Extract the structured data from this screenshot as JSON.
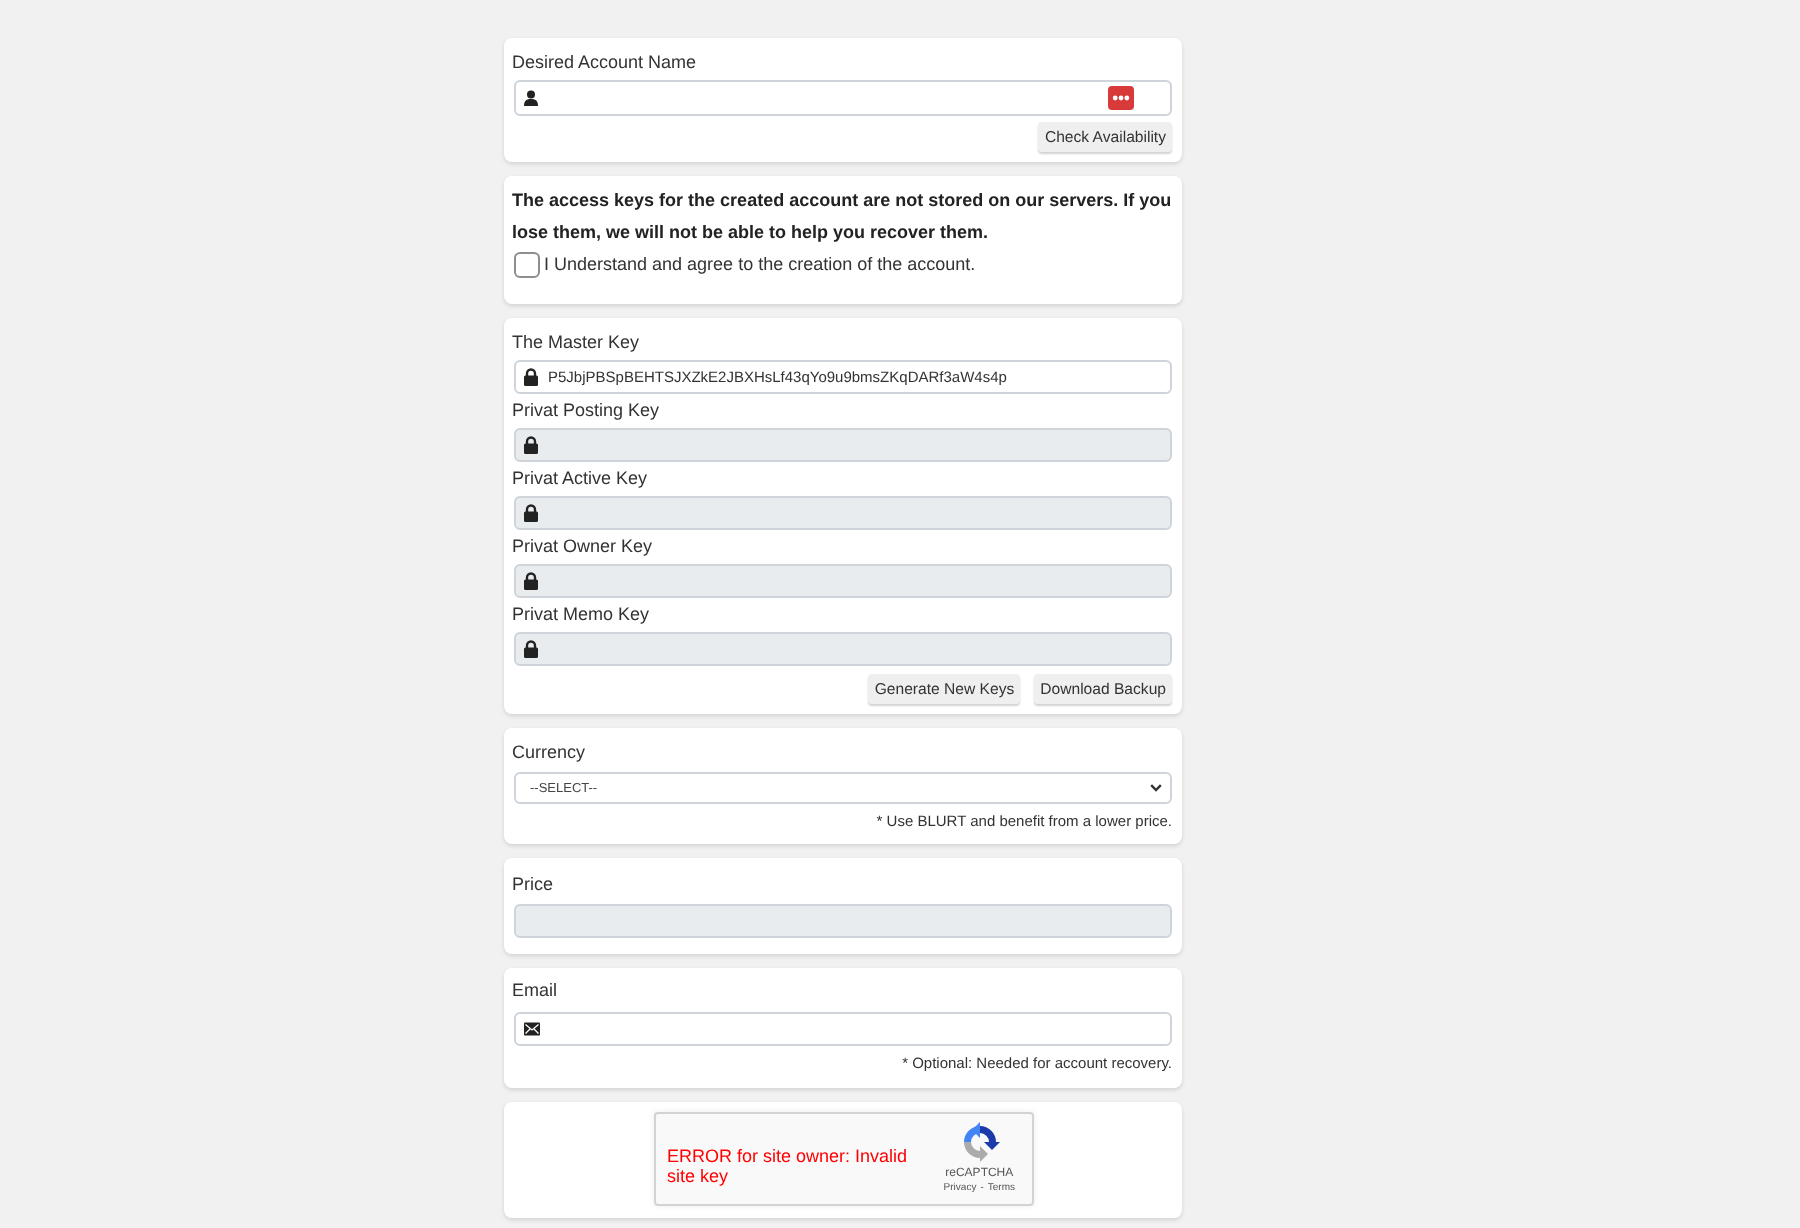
{
  "account_name": {
    "label": "Desired Account Name",
    "button": "Check Availability"
  },
  "notice": {
    "text": "The access keys for the created account are not stored on our servers. If you lose them, we will not be able to help you recover them.",
    "agreement": {
      "label": "I Understand and agree to the creation of the account.",
      "checked": false
    }
  },
  "keys": {
    "fields": [
      {
        "label": "The Master Key",
        "value": "P5JbjPBSpBEHTSJXZkE2JBXHsLf43qYo9u9bmsZKqDARf3aW4s4p",
        "disabled": false
      },
      {
        "label": "Privat Posting Key",
        "disabled": true
      },
      {
        "label": "Privat Active Key",
        "disabled": true
      },
      {
        "label": "Privat Owner Key",
        "disabled": true
      },
      {
        "label": "Privat Memo Key",
        "disabled": true
      }
    ],
    "buttons": [
      "Generate New Keys",
      "Download Backup"
    ]
  },
  "currency": {
    "label": "Currency",
    "value": "--SELECT--",
    "note": "* Use BLURT and benefit from a lower price."
  },
  "price": {
    "label": "Price",
    "disabled": true
  },
  "email": {
    "label": "Email",
    "note": "* Optional: Needed for account recovery."
  },
  "captcha": {
    "error": "ERROR for site owner: Invalid site key",
    "brand": "reCAPTCHA",
    "links": [
      "Privacy",
      "Terms"
    ],
    "separator": "-"
  }
}
